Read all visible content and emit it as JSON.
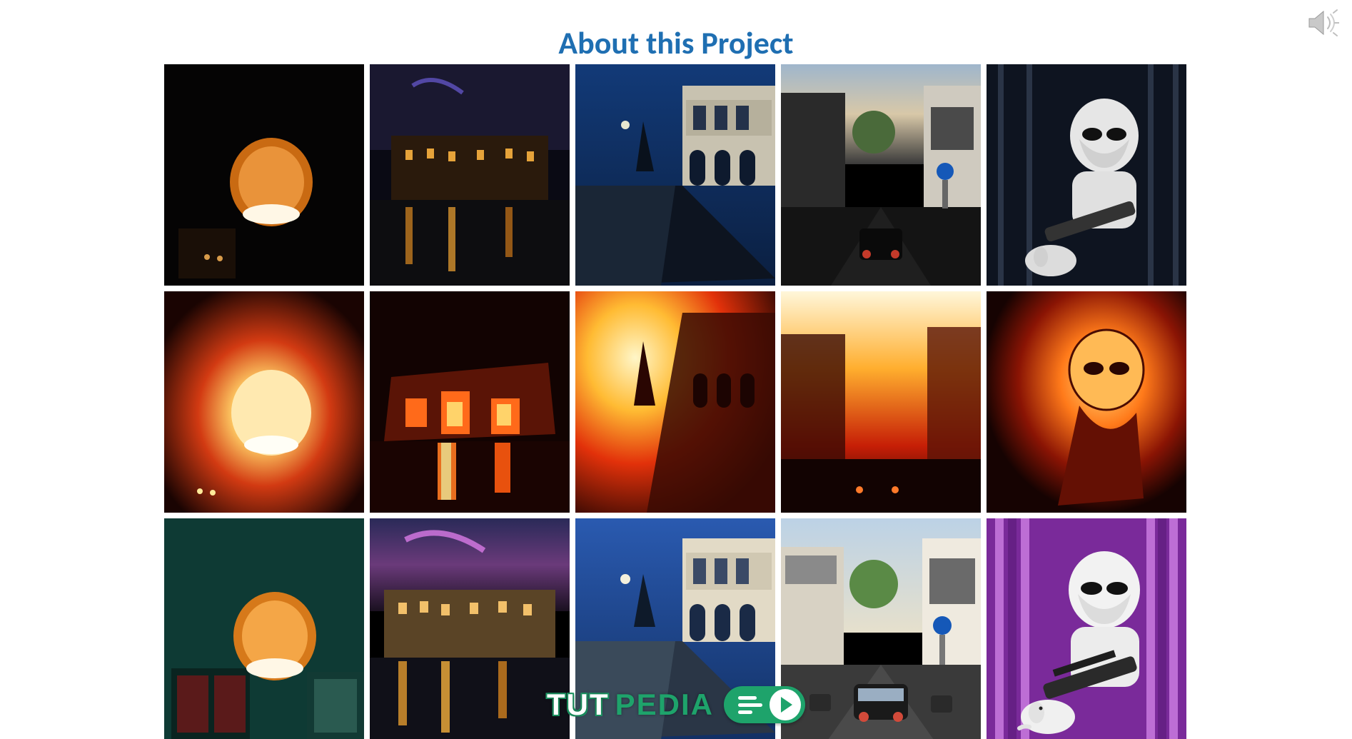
{
  "slide": {
    "title": "About this Project"
  },
  "watermark": {
    "part1": "TUT",
    "part2": "PEDIA"
  },
  "grid": {
    "cols": 5,
    "rows": 3,
    "cells": [
      {
        "name": "row1-lamp-dark"
      },
      {
        "name": "row1-venice-night"
      },
      {
        "name": "row1-cliff-building-dusk"
      },
      {
        "name": "row1-street-evening"
      },
      {
        "name": "row1-stormtrooper-dark"
      },
      {
        "name": "row2-lamp-heatmap"
      },
      {
        "name": "row2-venice-heatmap"
      },
      {
        "name": "row2-cliff-heatmap"
      },
      {
        "name": "row2-street-heatmap"
      },
      {
        "name": "row2-stormtrooper-heatmap"
      },
      {
        "name": "row3-lamp-enhanced"
      },
      {
        "name": "row3-venice-enhanced"
      },
      {
        "name": "row3-cliff-enhanced"
      },
      {
        "name": "row3-street-enhanced"
      },
      {
        "name": "row3-stormtrooper-enhanced"
      }
    ]
  }
}
